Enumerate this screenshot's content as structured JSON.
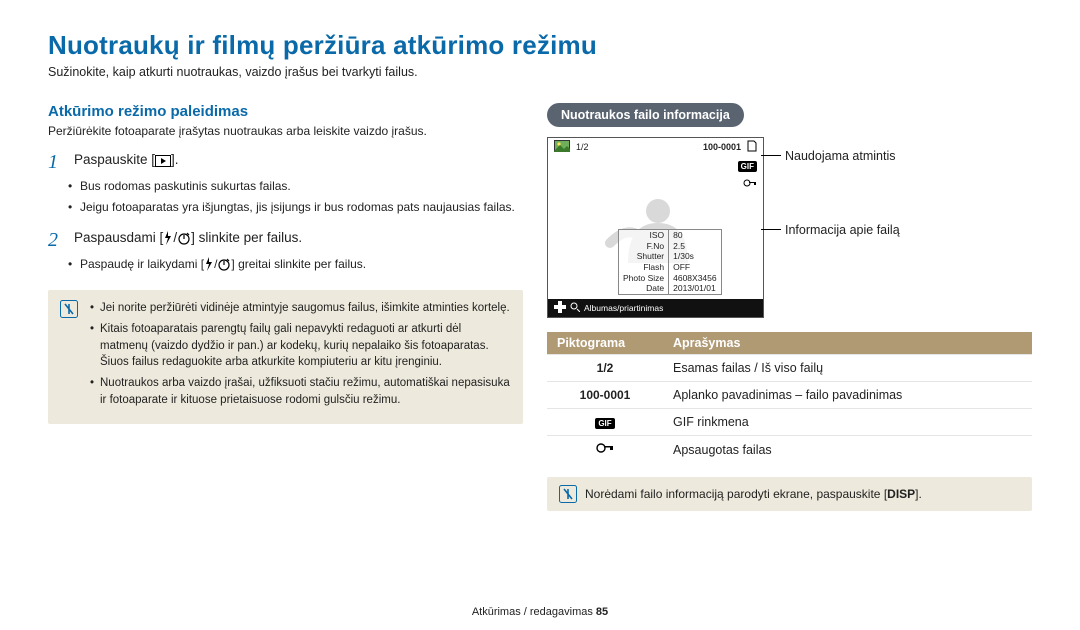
{
  "title": "Nuotraukų ir filmų peržiūra atkūrimo režimu",
  "lead": "Sužinokite, kaip atkurti nuotraukas, vaizdo įrašus bei tvarkyti failus.",
  "left": {
    "heading": "Atkūrimo režimo paleidimas",
    "desc": "Peržiūrėkite fotoaparate įrašytas nuotraukas arba leiskite vaizdo įrašus.",
    "step1": {
      "num": "1",
      "pre": "Paspauskite [",
      "post": "]."
    },
    "step1_bullets": [
      "Bus rodomas paskutinis sukurtas failas.",
      "Jeigu fotoaparatas yra išjungtas, jis įsijungs ir bus rodomas pats naujausias failas."
    ],
    "step2": {
      "num": "2",
      "pre": "Paspausdami [",
      "mid": "/",
      "post": "] slinkite per failus."
    },
    "step2_bullets": [
      {
        "pre": "Paspaudę ir laikydami [",
        "mid": "/",
        "post": "] greitai slinkite per failus."
      }
    ],
    "tips": [
      "Jei norite peržiūrėti vidinėje atmintyje saugomus failus, išimkite atminties kortelę.",
      "Kitais fotoaparatais parengtų failų gali nepavykti redaguoti ar atkurti dėl matmenų (vaizdo dydžio ir pan.) ar kodekų, kurių nepalaiko šis fotoaparatas. Šiuos failus redaguokite arba atkurkite kompiuteriu ar kitu įrenginiu.",
      "Nuotraukos arba vaizdo įrašai, užfiksuoti stačiu režimu, automatiškai nepasisuka ir fotoaparate ir kituose prietaisuose rodomi gulsčiu režimu."
    ]
  },
  "right": {
    "pill": "Nuotraukos failo informacija",
    "screen": {
      "counter": "1/2",
      "folder": "100-0001",
      "gif": "GIF",
      "meta": [
        [
          "ISO",
          "80"
        ],
        [
          "F.No",
          "2.5"
        ],
        [
          "Shutter",
          "1/30s"
        ],
        [
          "Flash",
          "OFF"
        ],
        [
          "Photo Size",
          "4608X3456"
        ],
        [
          "Date",
          "2013/01/01"
        ]
      ],
      "foot": "Albumas/priartinimas"
    },
    "labels": {
      "memory": "Naudojama atmintis",
      "file": "Informacija apie failą"
    },
    "thead": {
      "c1": "Piktograma",
      "c2": "Aprašymas"
    },
    "rows": [
      {
        "k": "1/2",
        "v": "Esamas failas / Iš viso failų"
      },
      {
        "k": "100-0001",
        "v": "Aplanko pavadinimas – failo pavadinimas"
      },
      {
        "k": "GIF",
        "v": "GIF rinkmena",
        "badge": "gif"
      },
      {
        "k": "🔑⊖",
        "v": "Apsaugotas failas",
        "badge": "key"
      }
    ],
    "tip": {
      "pre": "Norėdami failo informaciją parodyti ekrane, paspauskite [",
      "disp": "DISP",
      "post": "]."
    }
  },
  "footer": {
    "text": "Atkūrimas / redagavimas  ",
    "page": "85"
  }
}
